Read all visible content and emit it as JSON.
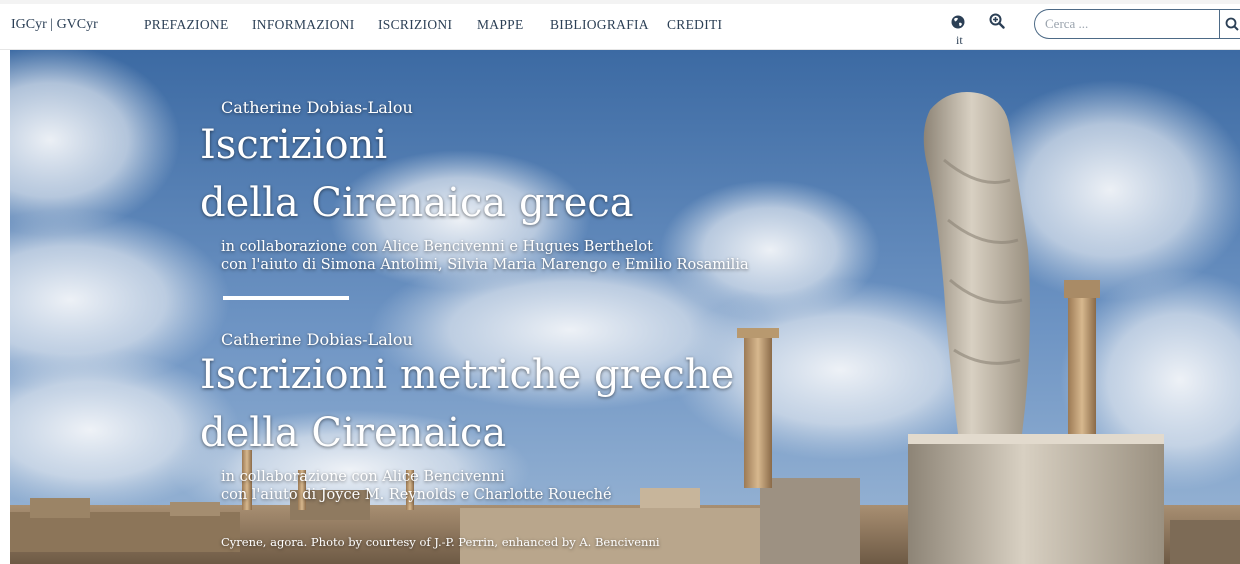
{
  "nav": {
    "brand": "IGCyr | GVCyr",
    "items": [
      "PREFAZIONE",
      "INFORMAZIONI",
      "ISCRIZIONI",
      "MAPPE",
      "BIBLIOGRAFIA",
      "CREDITI"
    ],
    "language": "it",
    "search_placeholder": "Cerca ..."
  },
  "hero": {
    "block1": {
      "author": "Catherine Dobias-Lalou",
      "title_line1": "Iscrizioni",
      "title_line2": "della Cirenaica greca",
      "collab": "in collaborazione con Alice Bencivenni e Hugues Berthelot",
      "help": "con l'aiuto di Simona Antolini, Silvia Maria Marengo e Emilio Rosamilia"
    },
    "block2": {
      "author": "Catherine Dobias-Lalou",
      "title_line1": "Iscrizioni metriche greche",
      "title_line2": "della Cirenaica",
      "collab": "in collaborazione con Alice Bencivenni",
      "help": "con l'aiuto di Joyce M. Reynolds e Charlotte Roueché"
    },
    "caption": "Cyrene, agora. Photo by courtesy of J.-P. Perrin, enhanced by A. Bencivenni"
  },
  "colors": {
    "nav_text": "#2b3f55",
    "sky_top": "#3f6fa8",
    "sky_bottom": "#8fb0d4",
    "stone": "#c9bfae"
  }
}
